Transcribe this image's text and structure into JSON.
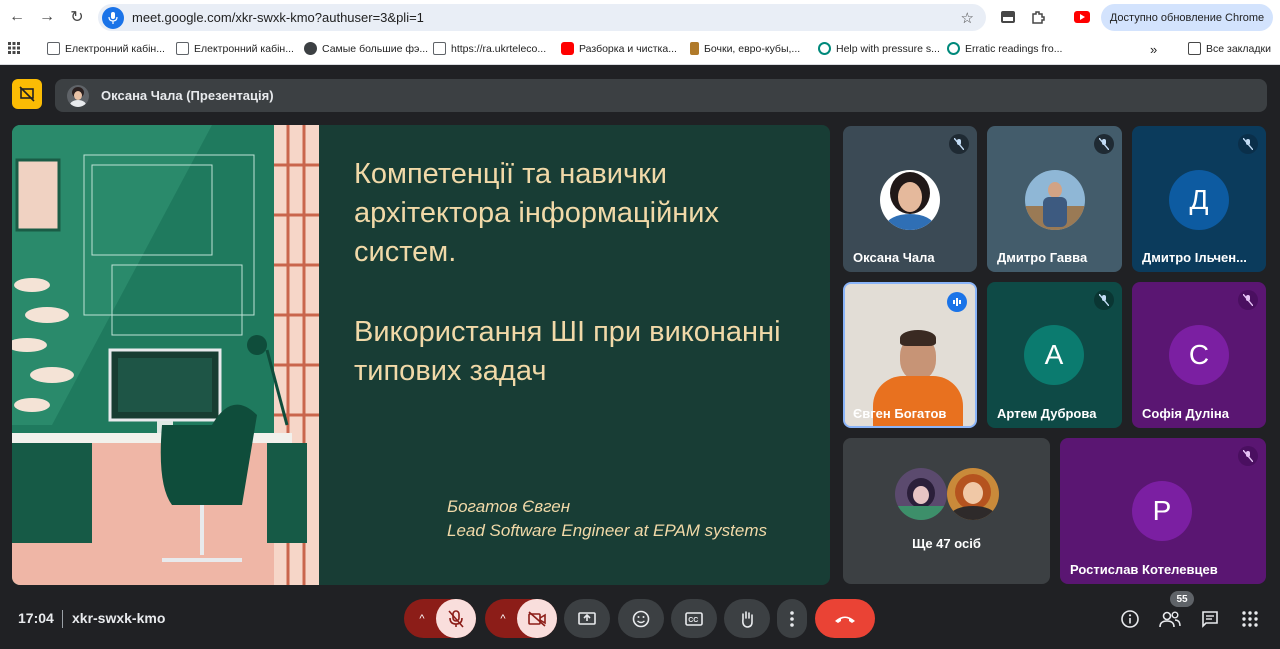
{
  "browser": {
    "url": "meet.google.com/xkr-swxk-kmo?authuser=3&pli=1",
    "update_label": "Доступно обновление Chrome"
  },
  "bookmarks": [
    {
      "label": "Електронний кабін...",
      "color": "#5f6368"
    },
    {
      "label": "Електронний кабін...",
      "color": "#5f6368"
    },
    {
      "label": "Самые большие фэ...",
      "color": "#3c4043"
    },
    {
      "label": "https://ra.ukrteleco...",
      "color": "#5f6368"
    },
    {
      "label": "Разборка и чистка...",
      "color": "#ff0000"
    },
    {
      "label": "Бочки, евро-кубы,...",
      "color": "#b07a2a"
    },
    {
      "label": "Help with pressure s...",
      "color": "#00897b"
    },
    {
      "label": "Erratic readings fro...",
      "color": "#00897b"
    }
  ],
  "bookmarks_all": "Все закладки",
  "meet": {
    "presenter_banner": "Оксана Чала (Презентація)",
    "slide": {
      "title": "Компетенції та навички архітектора інформаційних систем.",
      "subtitle": "Використання ШІ при виконанні типових задач",
      "author_name": "Богатов Євген",
      "author_role": "Lead Software Engineer at EPAM systems"
    },
    "participants": [
      {
        "name": "Оксана Чала",
        "muted": true
      },
      {
        "name": "Дмитро Гавва",
        "muted": true
      },
      {
        "name": "Дмитро Ільчен...",
        "letter": "Д",
        "muted": true
      },
      {
        "name": "Євген Богатов",
        "speaking": true
      },
      {
        "name": "Артем Дуброва",
        "letter": "А",
        "muted": true
      },
      {
        "name": "Софія Дуліна",
        "letter": "С",
        "muted": true
      },
      {
        "name": "Ростислав Котелевцев",
        "letter": "Р",
        "muted": true
      }
    ],
    "others_label": "Ще 47 осіб",
    "time": "17:04",
    "meeting_code": "xkr-swxk-kmo",
    "participant_count": "55"
  }
}
